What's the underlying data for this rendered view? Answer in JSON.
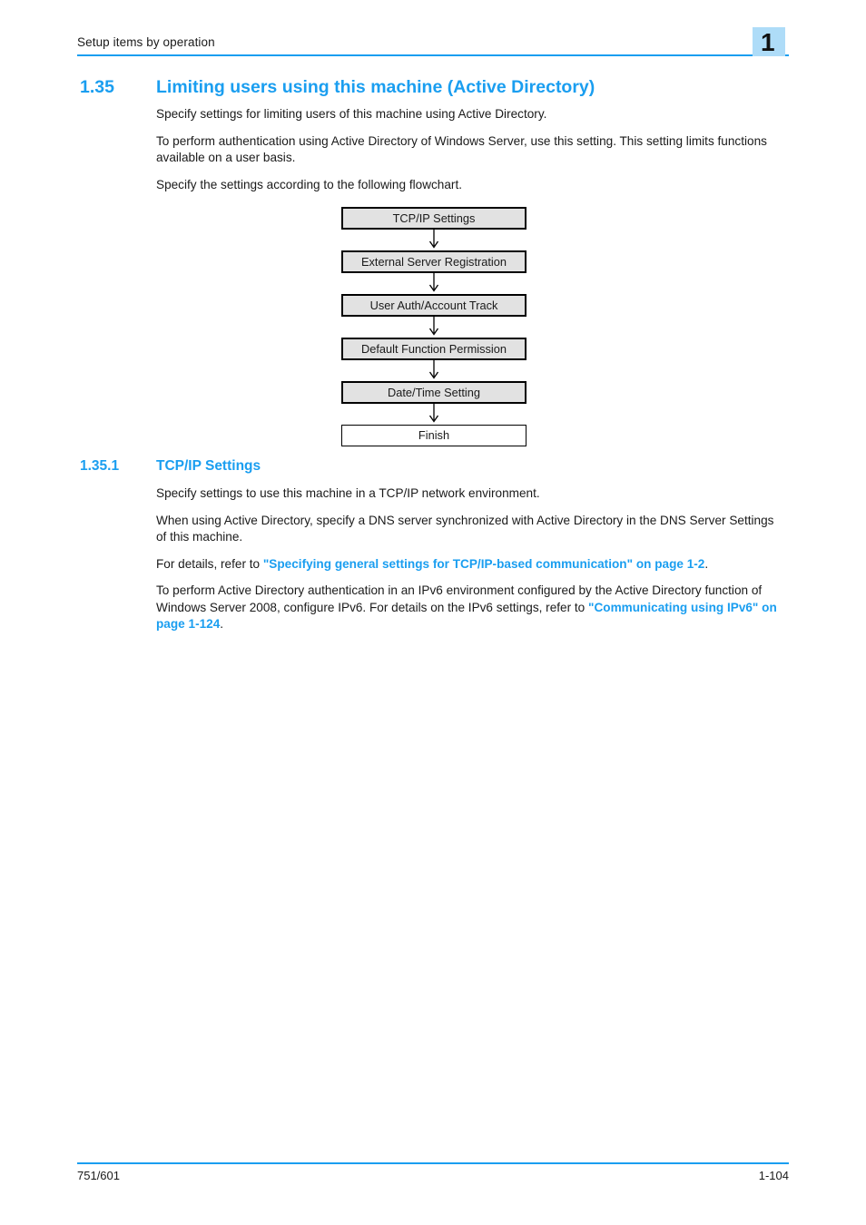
{
  "header": {
    "running_title": "Setup items by operation",
    "chapter_number": "1",
    "tab_color": "#aedcf8",
    "rule_color": "#1a9ef0"
  },
  "section": {
    "number": "1.35",
    "title": "Limiting users using this machine (Active Directory)",
    "accent_color": "#1a9ef0"
  },
  "intro": {
    "p1": "Specify settings for limiting users of this machine using Active Directory.",
    "p2": "To perform authentication using Active Directory of Windows Server, use this setting. This setting limits functions available on a user basis.",
    "p3": "Specify the settings according to the following flowchart."
  },
  "flowchart": {
    "nodes": [
      {
        "label": "TCP/IP Settings",
        "style": "filled"
      },
      {
        "label": "External Server Registration",
        "style": "filled"
      },
      {
        "label": "User Auth/Account Track",
        "style": "filled"
      },
      {
        "label": "Default Function Permission",
        "style": "filled"
      },
      {
        "label": "Date/Time Setting",
        "style": "filled"
      },
      {
        "label": "Finish",
        "style": "plain"
      }
    ],
    "fill_color": "#e2e2e2",
    "border_color": "#000000"
  },
  "subsection": {
    "number": "1.35.1",
    "title": "TCP/IP Settings"
  },
  "tcp_body": {
    "p1": "Specify settings to use this machine in a TCP/IP network environment.",
    "p2": "When using Active Directory, specify a DNS server synchronized with Active Directory in the DNS Server Settings of this machine.",
    "p3_prefix": "For details, refer to ",
    "p3_link": "\"Specifying general settings for TCP/IP-based communication\" on page 1-2",
    "p3_suffix": ".",
    "p4_prefix": "To perform Active Directory authentication in an IPv6 environment configured by the Active Directory function of Windows Server 2008, configure IPv6. For details on the IPv6 settings, refer to ",
    "p4_link": "\"Communicating using IPv6\" on page 1-124",
    "p4_suffix": "."
  },
  "footer": {
    "model": "751/601",
    "page_number": "1-104"
  }
}
